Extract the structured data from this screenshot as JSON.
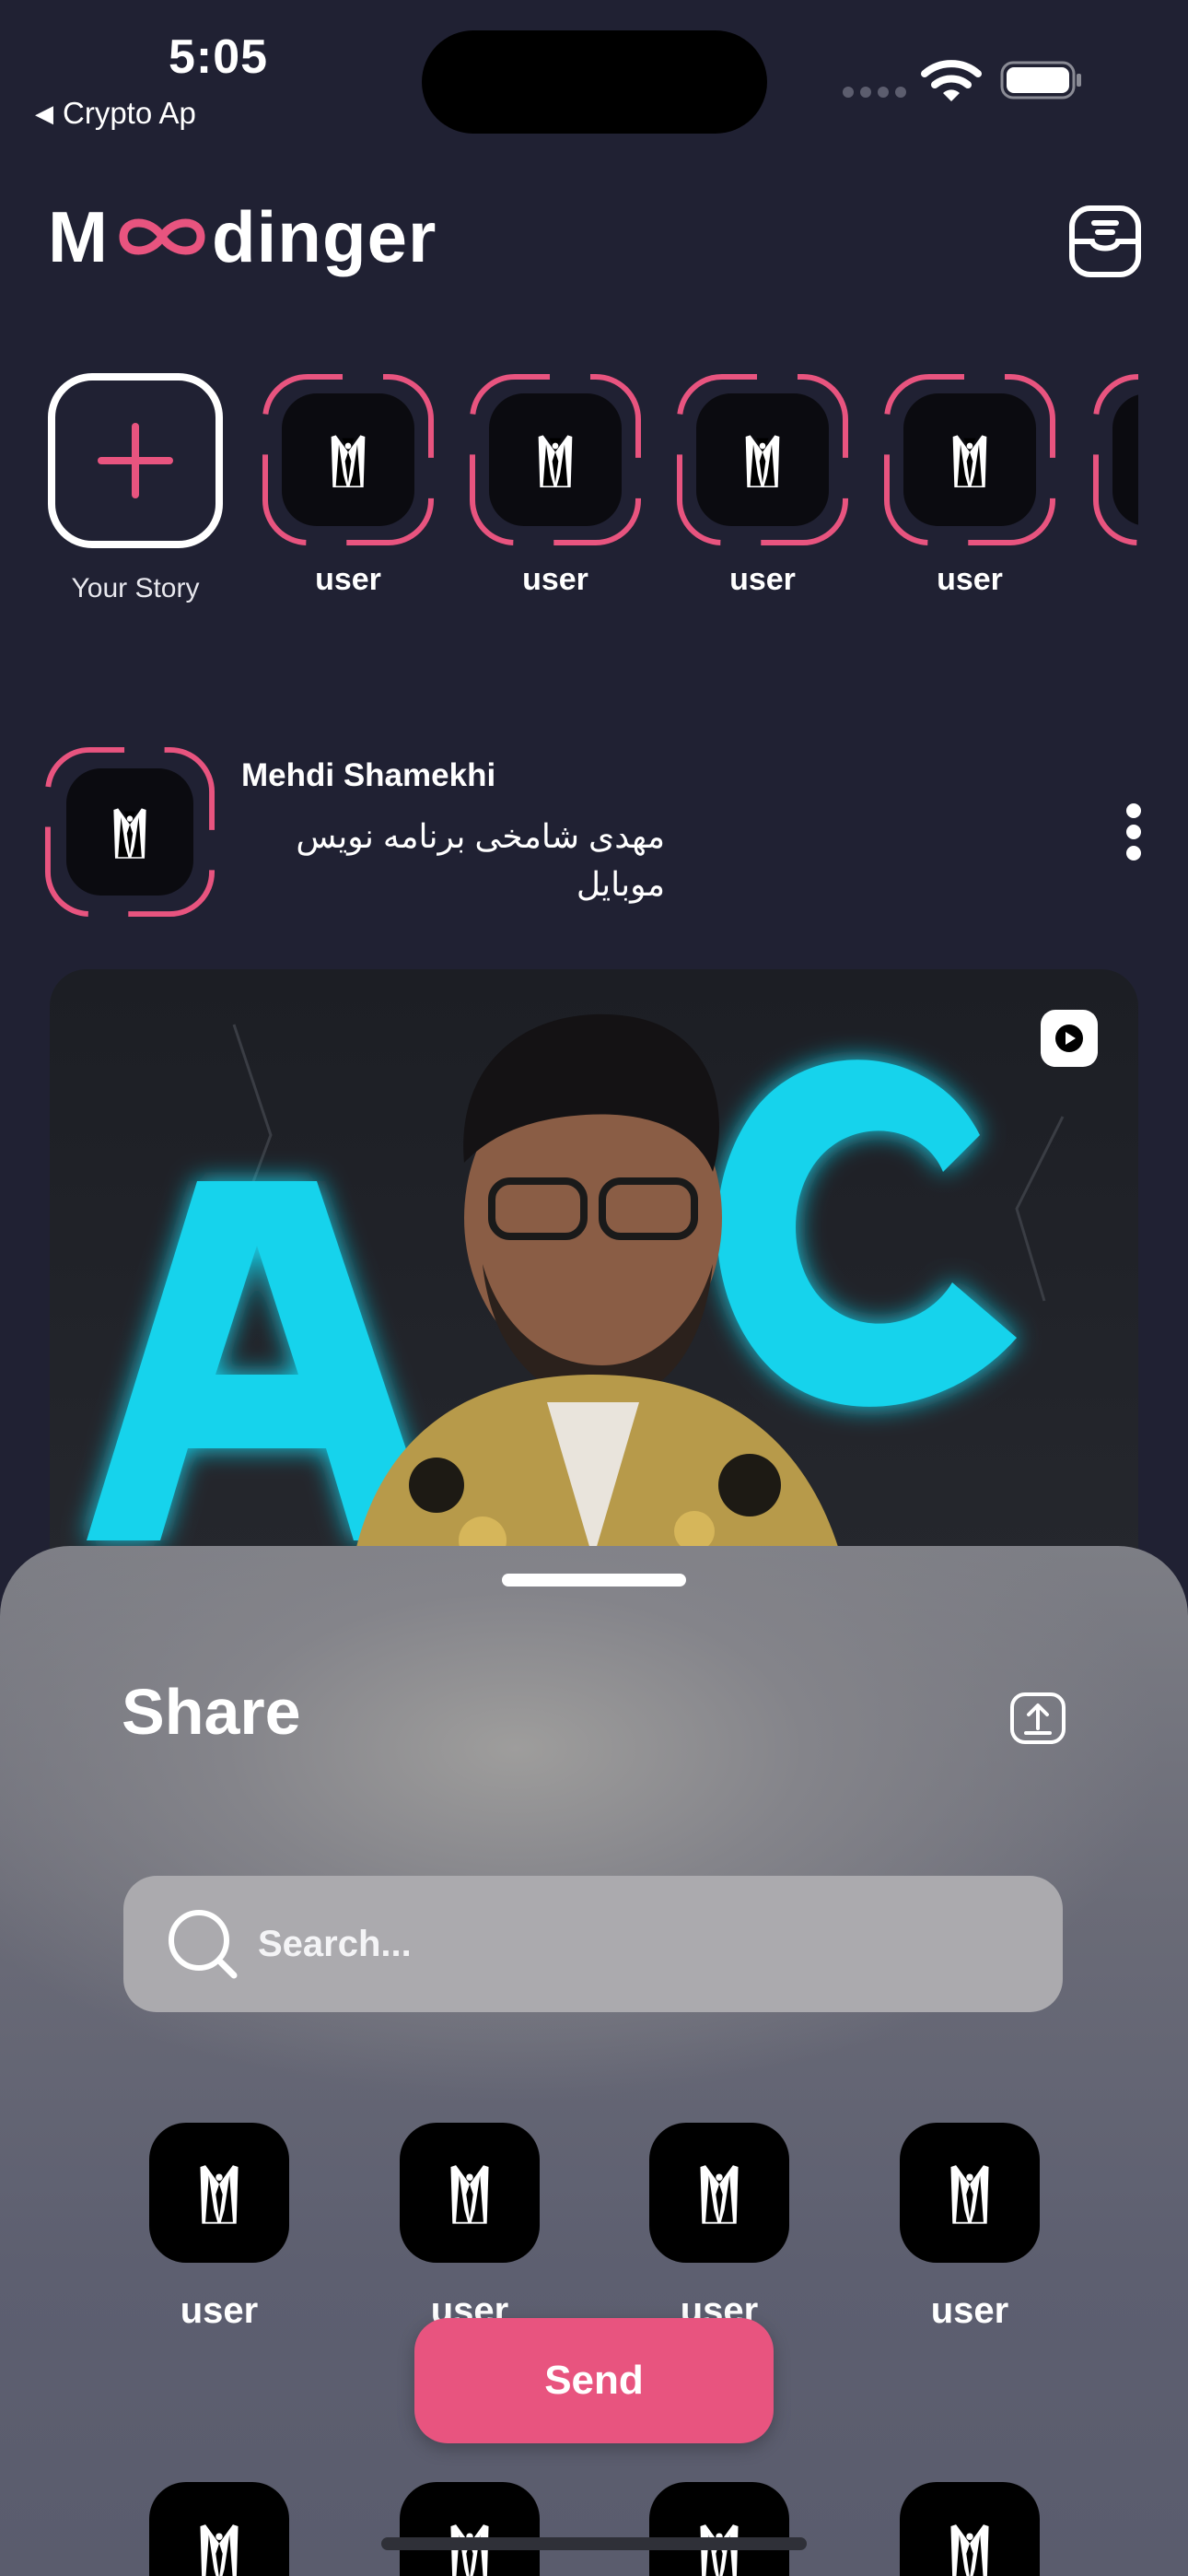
{
  "status_bar": {
    "time": "5:05",
    "back_app": "Crypto Ap",
    "back_icon": "back-triangle-icon"
  },
  "header": {
    "brand_left": "M",
    "brand_right": "dinger",
    "brand_infinity_color": "#e8547f",
    "inbox_icon": "inbox-icon"
  },
  "stories": {
    "add_label": "Your Story",
    "items": [
      {
        "label": "user"
      },
      {
        "label": "user"
      },
      {
        "label": "user"
      },
      {
        "label": "user"
      },
      {
        "label": ""
      }
    ]
  },
  "post": {
    "author": "Mehdi Shamekhi",
    "bio": "مهدی شامخی برنامه نویس موبایل",
    "image_text": "ABC",
    "video_icon": "play-icon",
    "more_icon": "more-vertical-icon"
  },
  "share_sheet": {
    "title": "Share",
    "upload_icon": "upload-icon",
    "search_placeholder": "Search...",
    "contacts": [
      {
        "name": "user"
      },
      {
        "name": "user"
      },
      {
        "name": "user"
      },
      {
        "name": "user"
      },
      {
        "name": ""
      },
      {
        "name": ""
      },
      {
        "name": ""
      },
      {
        "name": ""
      }
    ],
    "send_label": "Send"
  },
  "colors": {
    "background": "#202133",
    "accent": "#e8547f",
    "neon": "#19d3ec"
  }
}
